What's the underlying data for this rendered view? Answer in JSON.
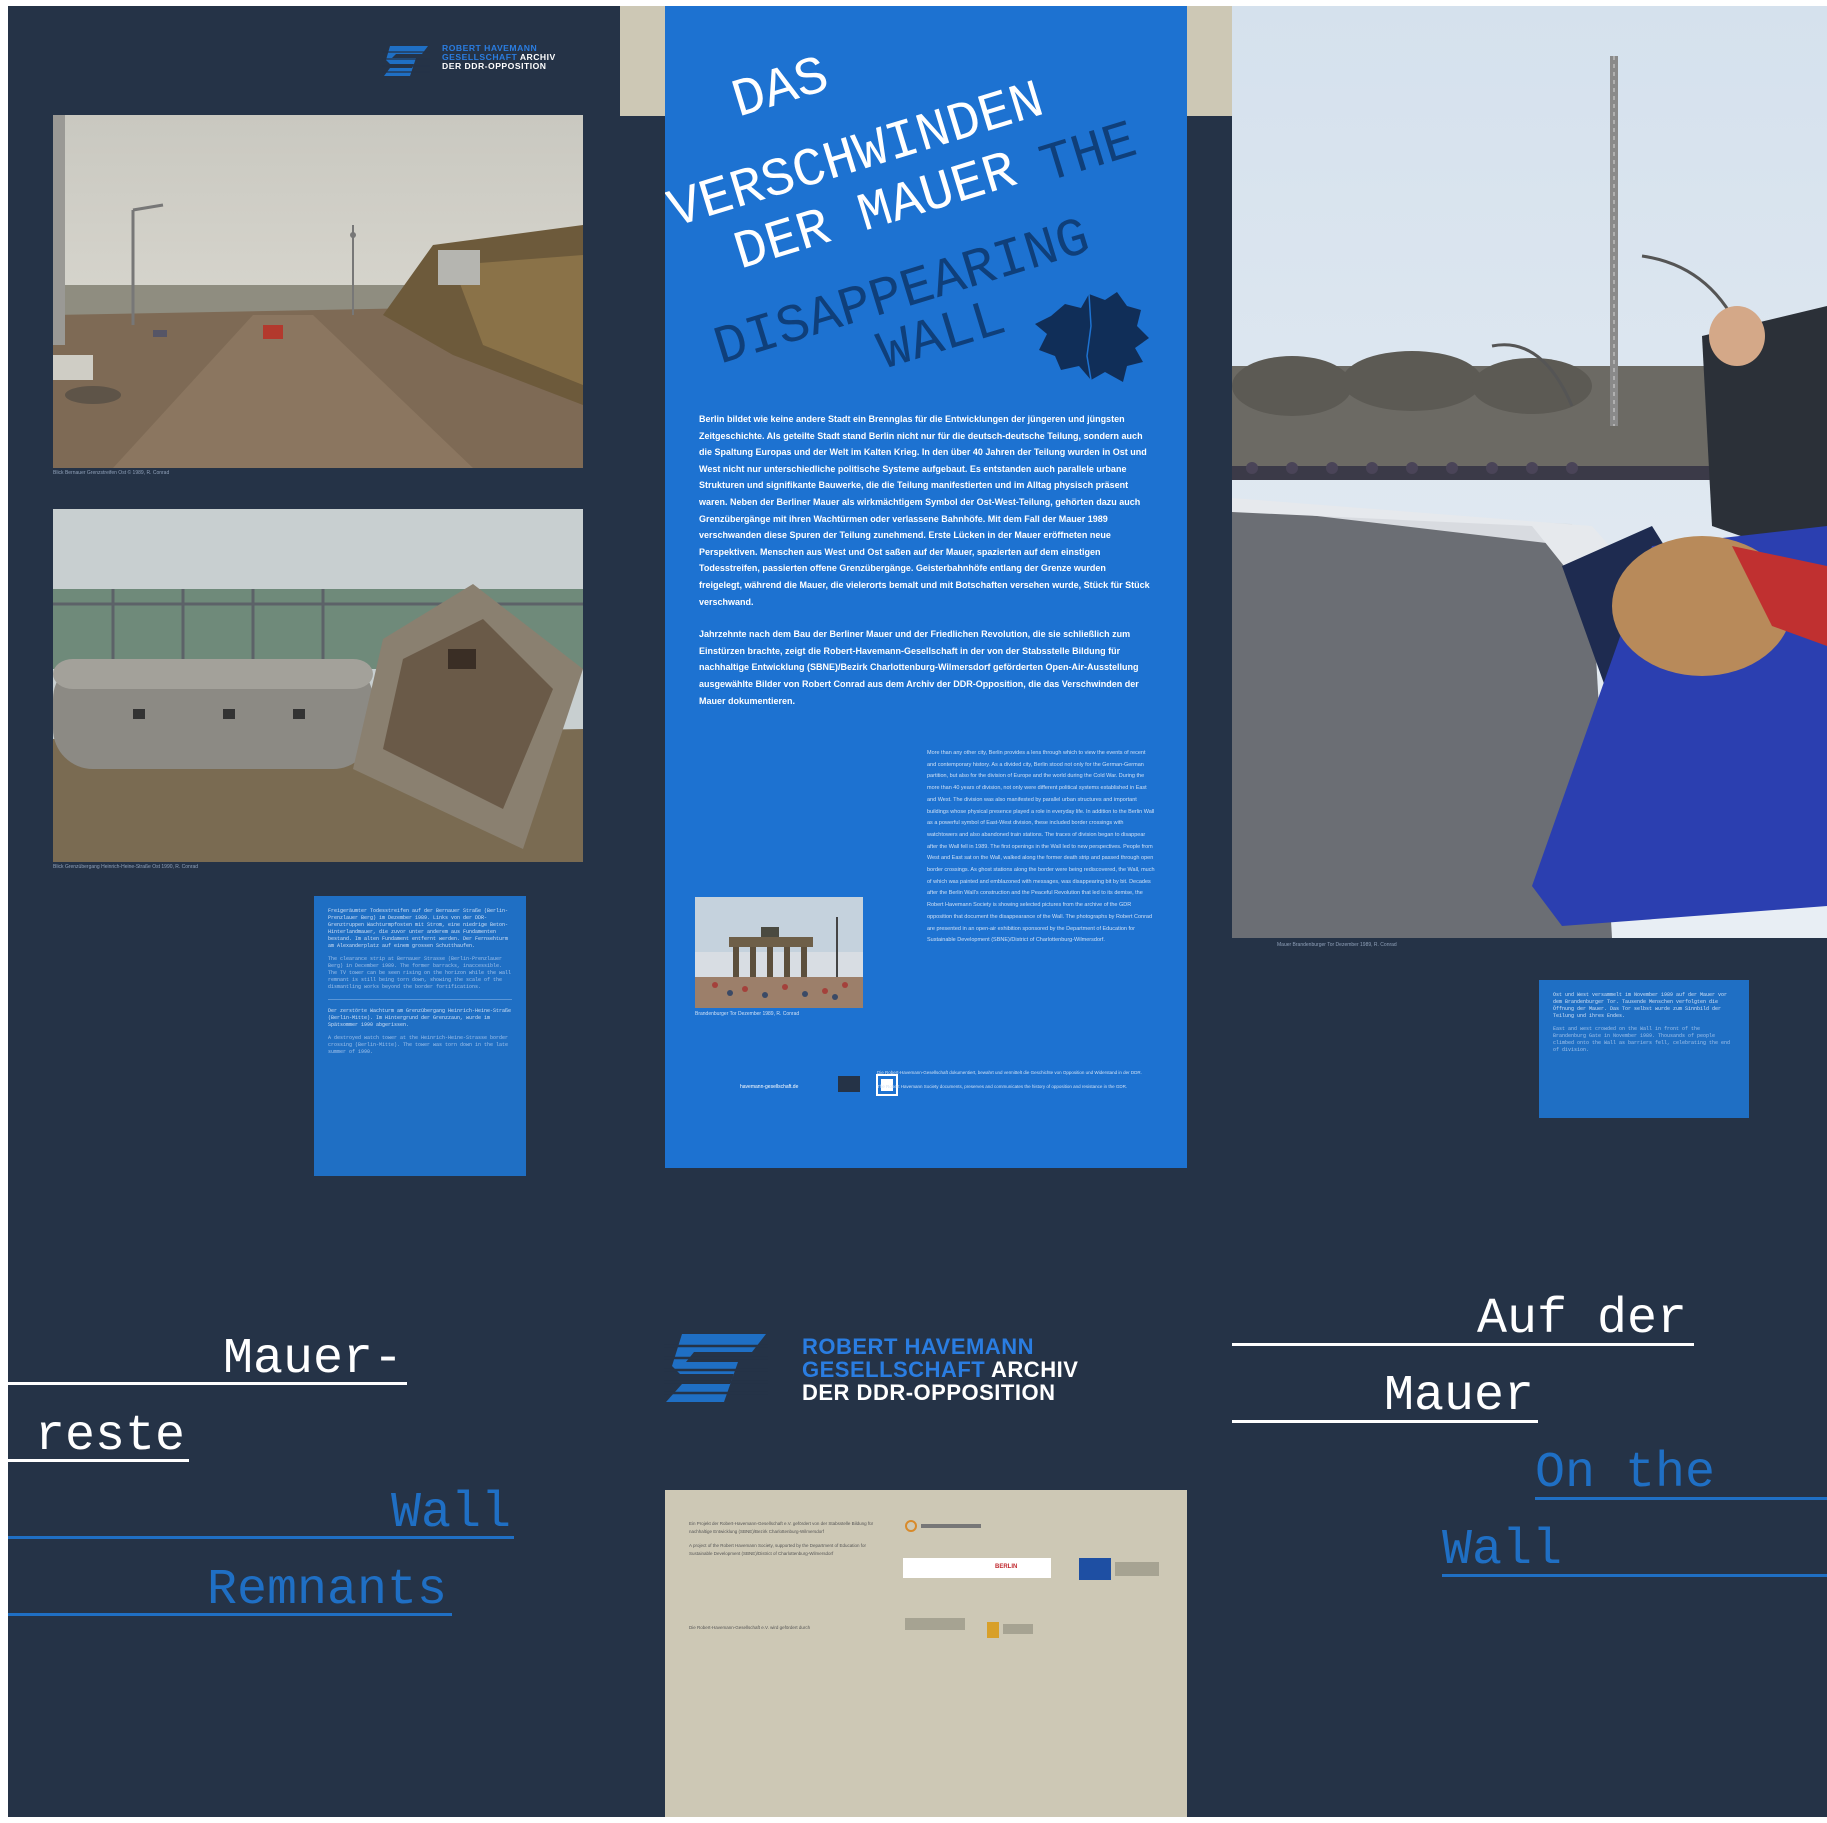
{
  "left_panel": {
    "logo": {
      "line1": "ROBERT HAVEMANN",
      "line2": "GESELLSCHAFT",
      "line2b": "ARCHIV",
      "line3": "DER DDR-OPPOSITION"
    },
    "photo1_caption": "Blick Bernauer Grenzstreifen Ost © 1989, R. Conrad",
    "photo2_caption": "Blick Grenzübergang Heinrich-Heine-Straße Ost 1990, R. Conrad",
    "card": {
      "p1": "Freigeräumter Todesstreifen auf der Bernauer Straße (Berlin-Prenzlauer Berg) im Dezember 1989. Links von der DDR-Grenztruppen Wachturmpfosten mit Strom, eine niedrige Beton-Hinterlandmauer, die zuvor unter anderem aus Fundamenten bestand. Im alten Fundament entfernt werden. Der Fernsehturm am Alexanderplatz auf einem grossen Schutthaufen.",
      "p2": "The clearance strip at Bernauer Strasse (Berlin-Prenzlauer Berg) in December 1989. The former barracks, inaccessible. The TV tower can be seen rising on the horizon while the wall remnant is still being torn down, showing the scale of the dismantling works beyond the border fortifications.",
      "p3": "Der zerstörte Wachturm am Grenzübergang Heinrich-Heine-Straße (Berlin-Mitte). Im Hintergrund der Grenzzaun, wurde im Spätsommer 1990 abgerissen.",
      "p4": "A destroyed watch tower at the Heinrich-Heine-Strasse border crossing (Berlin-Mitte). The tower was torn down in the late summer of 1990."
    },
    "title_de_1": "Mauer-",
    "title_de_2": "reste",
    "title_en_1": "Wall",
    "title_en_2": "Remnants"
  },
  "center_panel": {
    "poster": {
      "title_de_1": "DAS",
      "title_de_2": "VERSCHWINDEN",
      "title_de_3": "DER MAUER",
      "title_en_1": "THE",
      "title_en_2": "DISAPPEARING",
      "title_en_3": "WALL",
      "de_p1": "Berlin bildet wie keine andere Stadt ein Brennglas für die Entwicklungen der jüngeren und jüngsten Zeitgeschichte. Als geteilte Stadt stand Berlin nicht nur für die deutsch-deutsche Teilung, sondern auch die Spaltung Europas und der Welt im Kalten Krieg. In den über 40 Jahren der Teilung wurden in Ost und West nicht nur unterschiedliche politische Systeme aufgebaut. Es entstanden auch parallele urbane Strukturen und signifikante Bauwerke, die die Teilung manifestierten und im Alltag physisch präsent waren. Neben der Berliner Mauer als wirkmächtigem Symbol der Ost-West-Teilung, gehörten dazu auch Grenzübergänge mit ihren Wachtürmen oder verlassene Bahnhöfe. Mit dem Fall der Mauer 1989 verschwanden diese Spuren der Teilung zunehmend. Erste Lücken in der Mauer eröffneten neue Perspektiven. Menschen aus West und Ost saßen auf der Mauer, spazierten auf dem einstigen Todesstreifen, passierten offene Grenzübergänge. Geisterbahnhöfe entlang der Grenze wurden freigelegt, während die Mauer, die vielerorts bemalt und mit Botschaften versehen wurde, Stück für Stück verschwand.",
      "de_p2": "Jahrzehnte nach dem Bau der Berliner Mauer und der Friedlichen Revolution, die sie schließlich zum Einstürzen brachte, zeigt die Robert-Havemann-Gesellschaft in der von der Stabsstelle Bildung für nachhaltige Entwicklung (SBNE)/Bezirk Charlottenburg-Wilmersdorf geförderten Open-Air-Ausstellung ausgewählte Bilder von Robert Conrad aus dem Archiv der DDR-Opposition, die das Verschwinden der Mauer dokumentieren.",
      "en_text": "More than any other city, Berlin provides a lens through which to view the events of recent and contemporary history. As a divided city, Berlin stood not only for the German-German partition, but also for the division of Europe and the world during the Cold War. During the more than 40 years of division, not only were different political systems established in East and West. The division was also manifested by parallel urban structures and important buildings whose physical presence played a role in everyday life. In addition to the Berlin Wall as a powerful symbol of East-West division, these included border crossings with watchtowers and also abandoned train stations. The traces of division began to disappear after the Wall fell in 1989. The first openings in the Wall led to new perspectives. People from West and East sat on the Wall, walked along the former death strip and passed through open border crossings. As ghost stations along the border were being rediscovered, the Wall, much of which was painted and emblazoned with messages, was disappearing bit by bit. Decades after the Berlin Wall's construction and the Peaceful Revolution that led to its demise, the Robert Havemann Society is showing selected pictures from the archive of the GDR opposition that document the disappearance of the Wall. The photographs by Robert Conrad are presented in an open-air exhibition sponsored by the Department of Education for Sustainable Development (SBNE)/District of Charlottenburg-Wilmersdorf.",
      "photo_caption": "Brandenburger Tor Dezember 1989, R. Conrad",
      "credit_1": "Die Robert-Havemann-Gesellschaft dokumentiert, bewahrt und vermittelt die Geschichte von Opposition und Widerstand in der DDR.",
      "credit_2": "The Robert Havemann Society documents, preserves and communicates the history of opposition and resistance in the GDR.",
      "site_label": "havemann-gesellschaft.de"
    },
    "logo": {
      "line1": "ROBERT HAVEMANN",
      "line2": "GESELLSCHAFT",
      "line2b": "ARCHIV",
      "line3": "DER DDR-OPPOSITION"
    },
    "sponsor": {
      "text1": "Ein Projekt der Robert-Havemann-Gesellschaft e.V. gefördert von der Stabsstelle Bildung für nachhaltige Entwicklung (SBNE)/Bezirk Charlottenburg-Wilmersdorf",
      "text2": "A project of the Robert Havemann Society, supported by the Department of Education for Sustainable Development (SBNE)/District of Charlottenburg-Wilmersdorf",
      "text3": "Die Robert-Havemann-Gesellschaft e.V. wird gefördert durch",
      "logo_berlin": "BERLIN"
    }
  },
  "right_panel": {
    "photo_caption": "Mauer Brandenburger Tor Dezember 1989, R. Conrad",
    "card": {
      "p1": "Ost und West versammelt im November 1989 auf der Mauer vor dem Brandenburger Tor. Tausende Menschen verfolgten die Öffnung der Mauer. Das Tor selbst wurde zum Sinnbild der Teilung und ihres Endes.",
      "p2": "East and west crowded on the Wall in front of the Brandenburg Gate in November 1989. Thousands of people climbed onto the Wall as barriers fell, celebrating the end of division."
    },
    "title_de_1": "Auf der",
    "title_de_2": "Mauer",
    "title_en_1": "On the",
    "title_en_2": "Wall"
  },
  "colors": {
    "background": "#253347",
    "accent_blue": "#1f6fc4",
    "poster_blue": "#1d72d1",
    "title_blue_dark": "#0f3f7a",
    "beige": "#cdc8b5",
    "rule_white": "#ffffff",
    "rule_blue": "#1f6fc4"
  }
}
